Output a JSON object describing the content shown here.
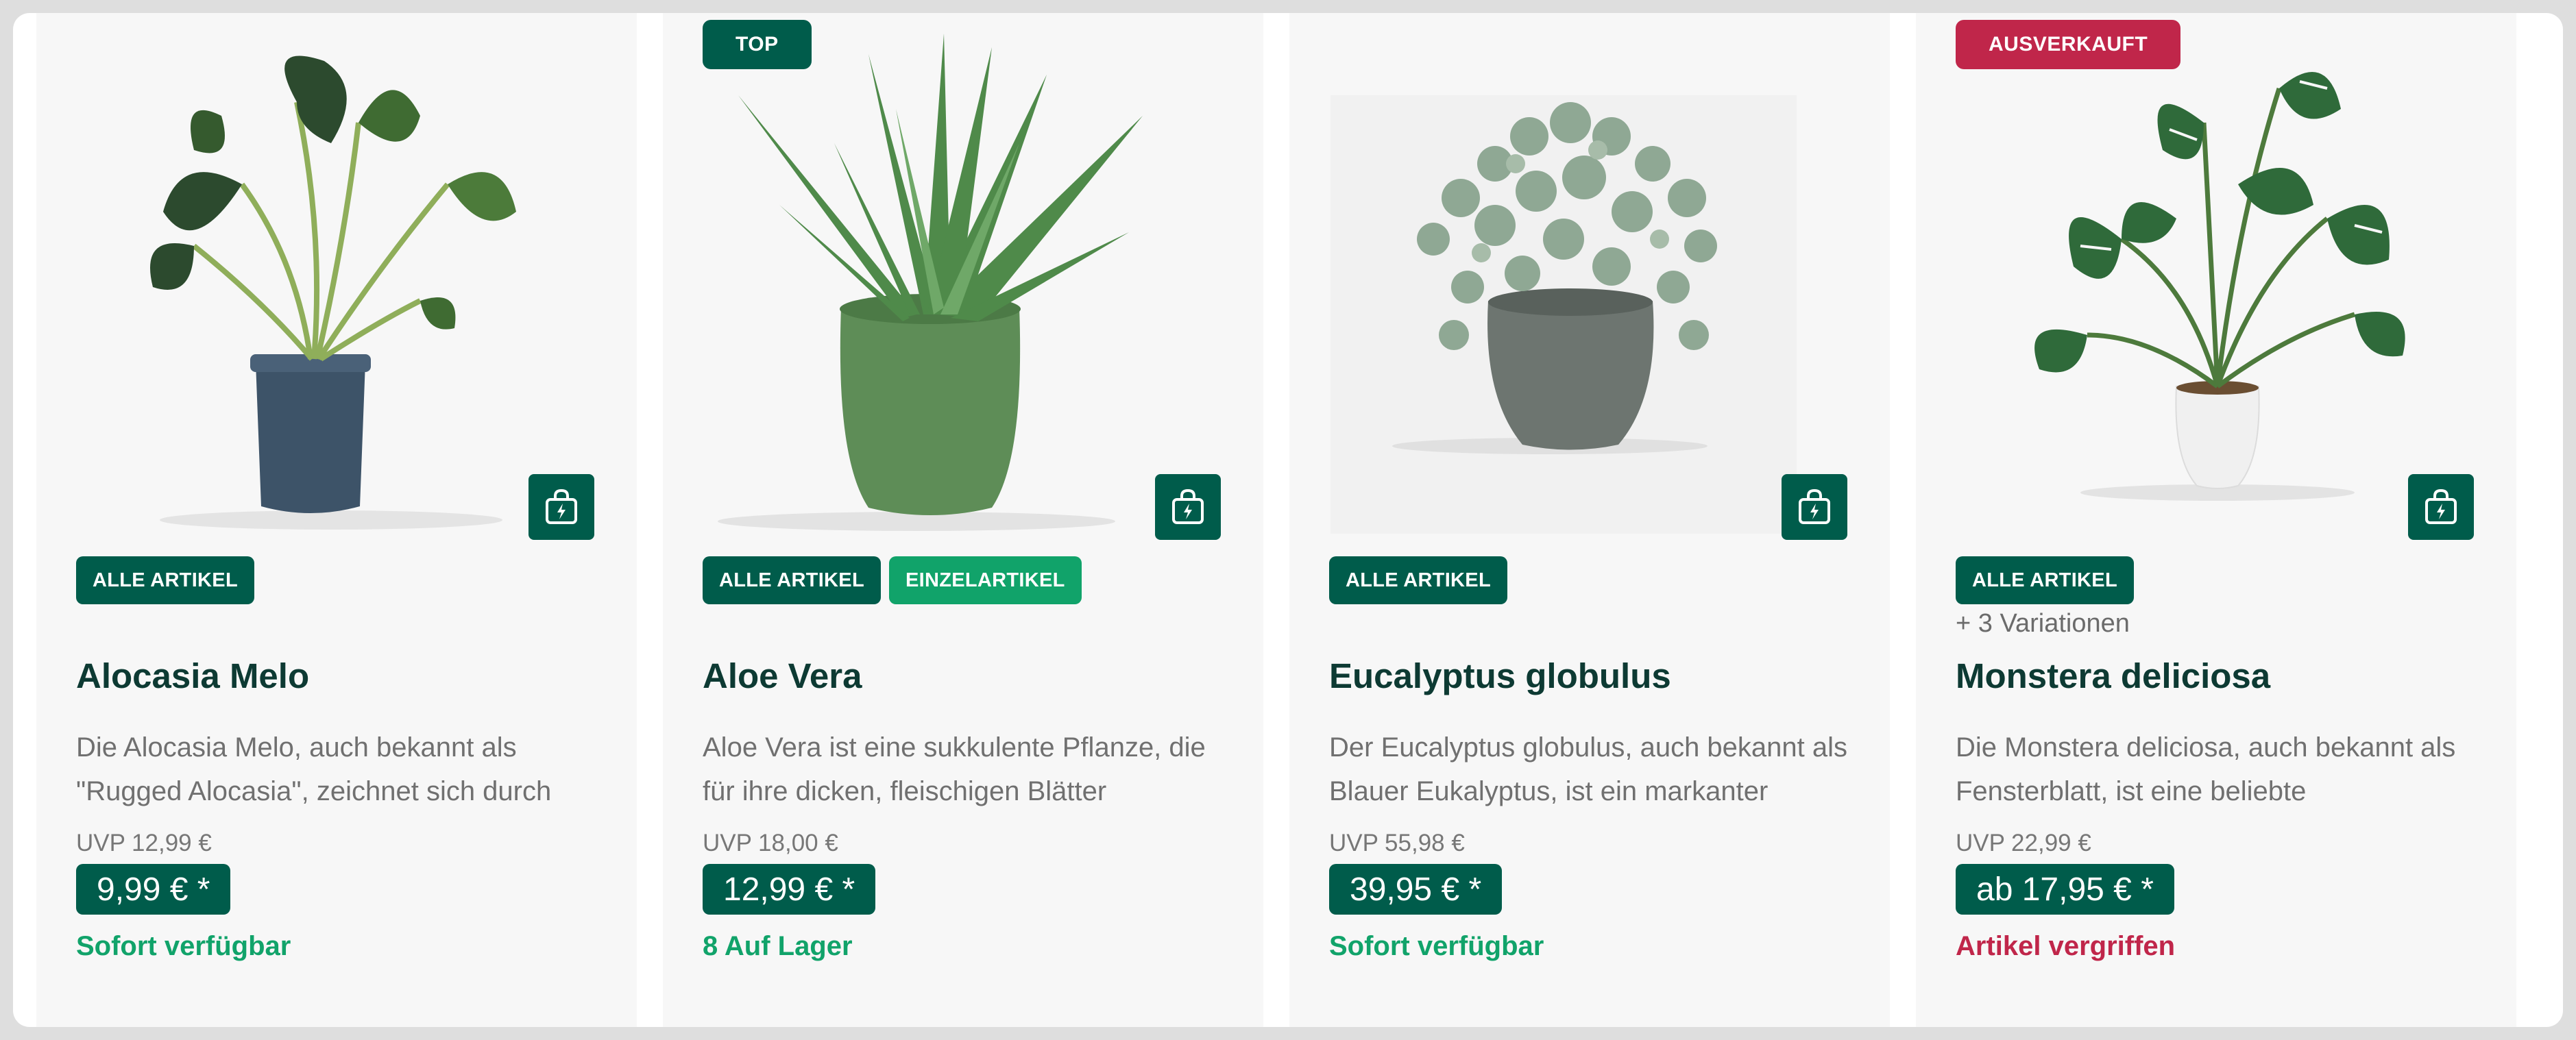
{
  "colors": {
    "brand": "#005c4b",
    "accent_green": "#11a36a",
    "sold_out": "#c0264a",
    "card_bg": "#f7f7f7"
  },
  "cart_icon": "shopping-bag-lightning-icon",
  "products": [
    {
      "image": "alocasia-plant-in-blue-pot",
      "ribbon": "",
      "tags": [
        "ALLE ARTIKEL"
      ],
      "variations": "",
      "name": "Alocasia Melo",
      "description": "Die Alocasia Melo, auch bekannt als \"Rugged Alocasia\", zeichnet sich durch",
      "uvp": "UVP 12,99 €",
      "price": "9,99 € *",
      "stock": "Sofort verfügbar"
    },
    {
      "image": "aloe-vera-in-green-pot",
      "ribbon": "TOP",
      "tags": [
        "ALLE ARTIKEL",
        "EINZELARTIKEL"
      ],
      "variations": "",
      "name": "Aloe Vera",
      "description": "Aloe Vera ist eine sukkulente Pflanze, die für ihre dicken, fleischigen Blätter",
      "uvp": "UVP 18,00 €",
      "price": "12,99 € *",
      "stock": "8 Auf Lager"
    },
    {
      "image": "eucalyptus-in-grey-pot",
      "ribbon": "",
      "tags": [
        "ALLE ARTIKEL"
      ],
      "variations": "",
      "name": "Eucalyptus globulus",
      "description": "Der Eucalyptus globulus, auch bekannt als Blauer Eukalyptus, ist ein markanter",
      "uvp": "UVP 55,98 €",
      "price": "39,95 € *",
      "stock": "Sofort verfügbar"
    },
    {
      "image": "monstera-in-white-pot",
      "ribbon": "AUSVERKAUFT",
      "tags": [
        "ALLE ARTIKEL"
      ],
      "variations": "+ 3 Variationen",
      "name": "Monstera deliciosa",
      "description": "Die Monstera deliciosa, auch bekannt als Fensterblatt, ist eine beliebte",
      "uvp": "UVP 22,99 €",
      "price": "ab 17,95 € *",
      "stock": "Artikel vergriffen"
    }
  ]
}
